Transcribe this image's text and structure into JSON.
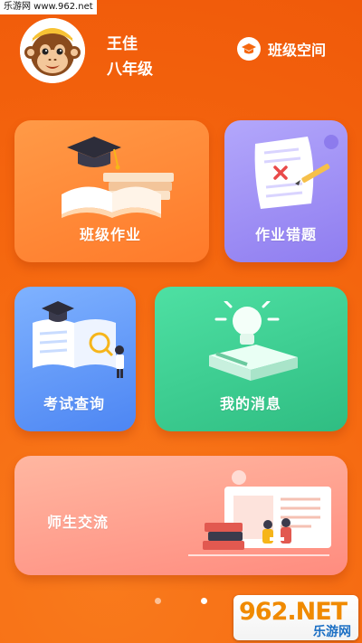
{
  "watermark_top": "乐游网 www.962.net",
  "user": {
    "name": "王佳",
    "grade": "八年级"
  },
  "header": {
    "class_space_label": "班级空间"
  },
  "cards": [
    {
      "label": "班级作业"
    },
    {
      "label": "作业错题"
    },
    {
      "label": "考试查询"
    },
    {
      "label": "我的消息"
    },
    {
      "label": "师生交流"
    }
  ],
  "pager": {
    "count": 2,
    "active": 2
  },
  "watermark_bottom": {
    "big": "962.NET",
    "small": "乐游网"
  },
  "colors": {
    "background": "#f5670f",
    "card_homework": "#ff8a3a",
    "card_mistakes": "#9f90f5",
    "card_exam": "#5f97f7",
    "card_messages": "#38c98d",
    "card_chat": "#ff9a8a"
  },
  "icons": [
    "monkey-avatar-icon",
    "graduation-cap-icon",
    "book-icon",
    "test-paper-icon",
    "magnifier-icon",
    "lightbulb-icon",
    "person-reading-icon"
  ]
}
